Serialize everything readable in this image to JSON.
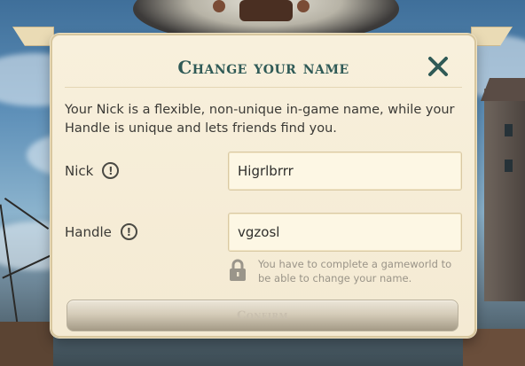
{
  "dialog": {
    "title": "Change your name",
    "close_icon": "close-x-icon",
    "description": "Your Nick is a flexible, non-unique in-game name, while your Handle is unique and lets friends find you.",
    "nick": {
      "label": "Nick",
      "info_icon": "info-icon",
      "value": "Higrlbrrr"
    },
    "handle": {
      "label": "Handle",
      "info_icon": "info-icon",
      "value": "vgzosl"
    },
    "lock_notice": {
      "icon": "lock-icon",
      "text": "You have to complete a gameworld to be able to change your name."
    },
    "confirm_label": "Confirm",
    "confirm_enabled": false
  },
  "colors": {
    "title": "#2f5a56",
    "panel": "#f6eed8",
    "panel_border": "#d8c79f",
    "body_text": "#3b3a36",
    "muted_text": "#9a9488",
    "button_disabled_text": "#c8bfae"
  }
}
